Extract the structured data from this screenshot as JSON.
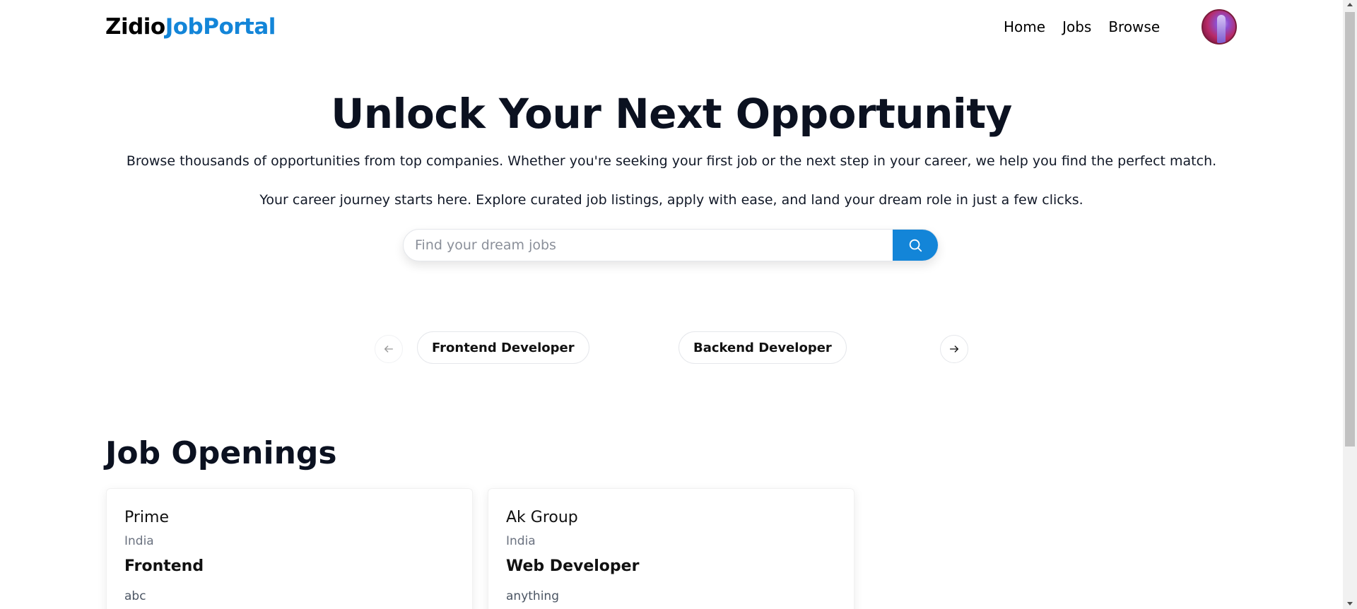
{
  "navbar": {
    "logo_part1": "Zidio",
    "logo_part2": "JobPortal",
    "links": [
      "Home",
      "Jobs",
      "Browse"
    ],
    "avatar_icon": "user-avatar"
  },
  "hero": {
    "title": "Unlock Your Next Opportunity",
    "subtitle1": "Browse thousands of opportunities from top companies. Whether you're seeking your first job or the next step in your career, we help you find the perfect match.",
    "subtitle2": "Your career journey starts here. Explore curated job listings, apply with ease, and land your dream role in just a few clicks."
  },
  "search": {
    "placeholder": "Find your dream jobs",
    "value": "",
    "button_icon": "search-icon"
  },
  "carousel": {
    "prev_icon": "arrow-left-icon",
    "next_icon": "arrow-right-icon",
    "categories": [
      "Frontend Developer",
      "Backend Developer"
    ]
  },
  "jobs": {
    "section_title": "Job Openings",
    "cards": [
      {
        "company": "Prime",
        "location": "India",
        "role": "Frontend",
        "description": "abc"
      },
      {
        "company": "Ak Group",
        "location": "India",
        "role": "Web Developer",
        "description": "anything"
      }
    ]
  },
  "colors": {
    "accent": "#1385d8",
    "heading": "#0b1120",
    "muted": "#6b7280"
  }
}
